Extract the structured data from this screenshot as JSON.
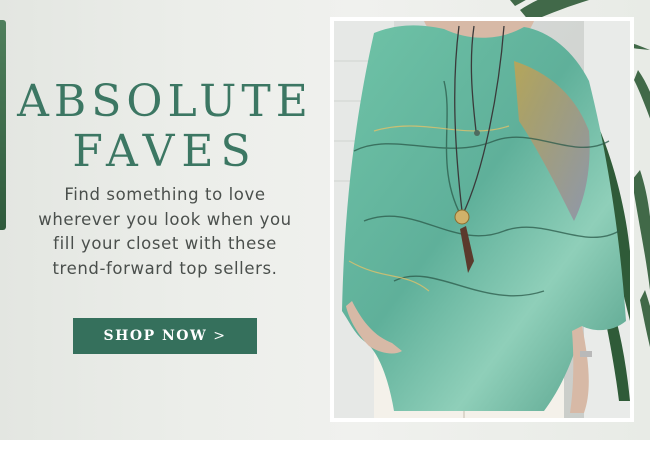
{
  "hero": {
    "headline_line1": "ABSOLUTE",
    "headline_line2": "FAVES",
    "body": "Find something to love wherever you look when you fill your closet with these trend-forward top sellers.",
    "cta_label": "SHOP NOW",
    "cta_arrow": ">"
  },
  "photo": {
    "subject": "model-wearing-marble-print-top",
    "icon": "product-photo"
  },
  "colors": {
    "accent": "#35705c",
    "headline": "#3c7763",
    "background": "#eceeea"
  }
}
